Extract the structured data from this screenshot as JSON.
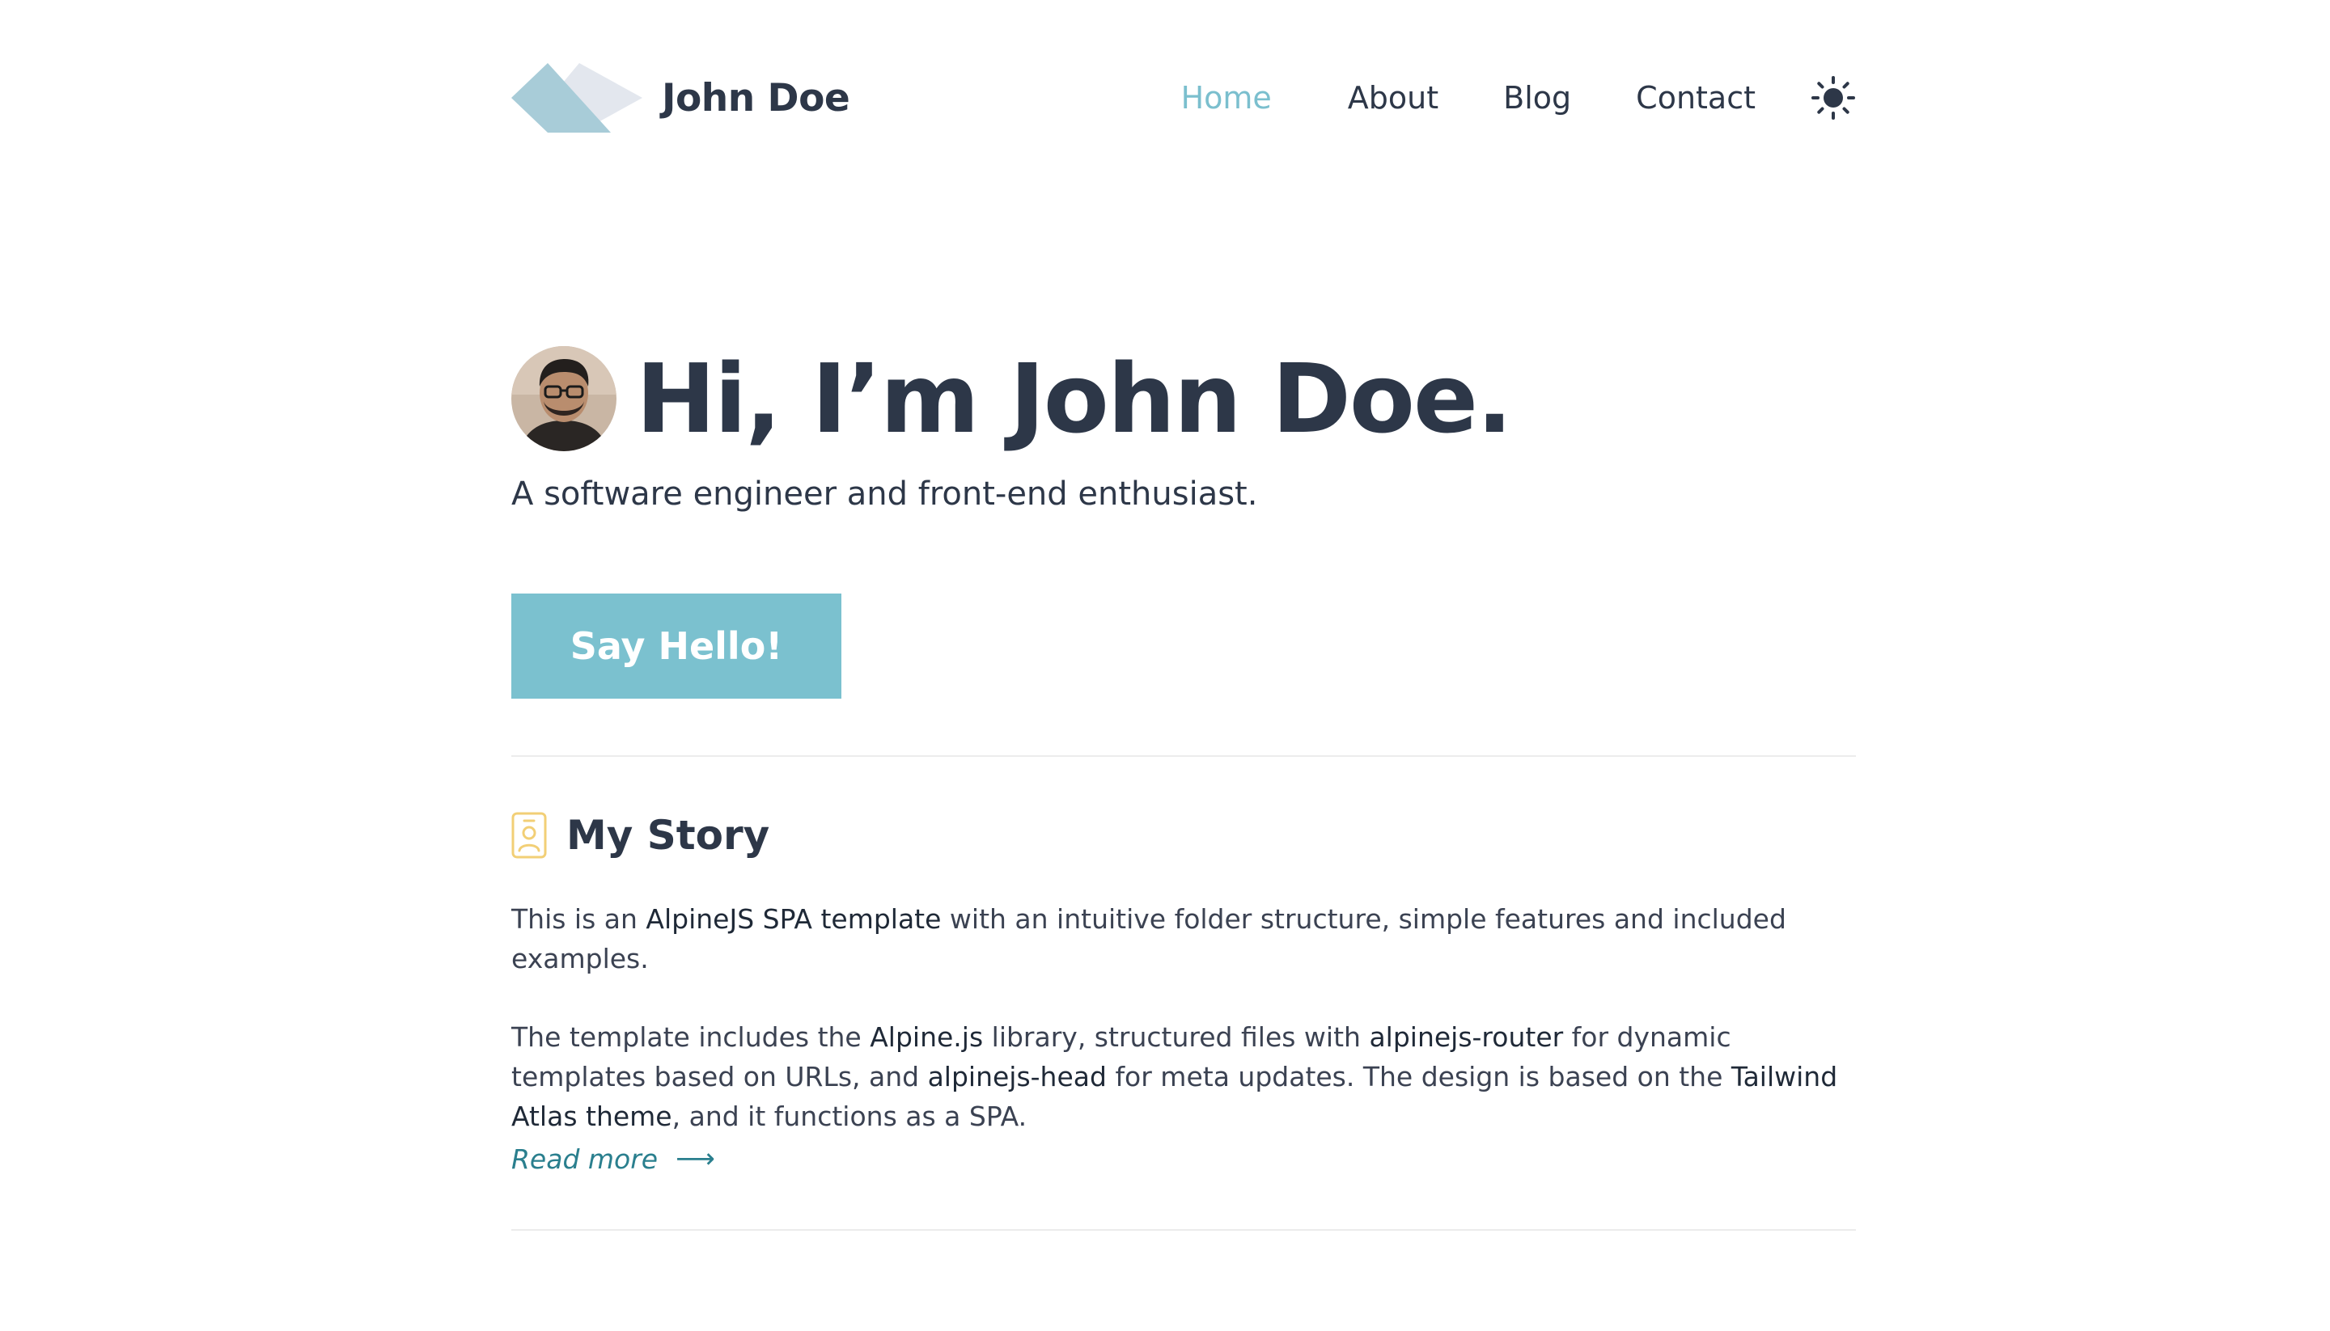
{
  "header": {
    "brand_name": "John Doe",
    "nav": [
      {
        "label": "Home",
        "active": true
      },
      {
        "label": "About",
        "active": false
      },
      {
        "label": "Blog",
        "active": false
      },
      {
        "label": "Contact",
        "active": false
      }
    ],
    "theme_icon": "sun-icon"
  },
  "hero": {
    "title": "Hi, I’m John Doe.",
    "subtitle": "A software engineer and front-end enthusiast.",
    "cta_label": "Say Hello!"
  },
  "story": {
    "title": "My Story",
    "icon": "id-card-icon",
    "p1": {
      "t1": "This is an ",
      "b1": "AlpineJS SPA template",
      "t2": " with an intuitive folder structure, simple features and included examples."
    },
    "p2": {
      "t1": "The template includes the ",
      "b1": "Alpine.js",
      "t2": " library, structured files with ",
      "b2": "alpinejs-router",
      "t3": " for dynamic templates based on URLs, and ",
      "b3": "alpinejs-head",
      "t4": " for meta updates. The design is based on the ",
      "b4": "Tailwind Atlas theme",
      "t5": ", and it functions as a SPA."
    },
    "read_more": "Read more",
    "read_more_arrow": "⟶"
  },
  "colors": {
    "accent": "#7bc1cf",
    "highlight": "#f6e09a",
    "text": "#2d3748",
    "link": "#2a7f8e"
  }
}
